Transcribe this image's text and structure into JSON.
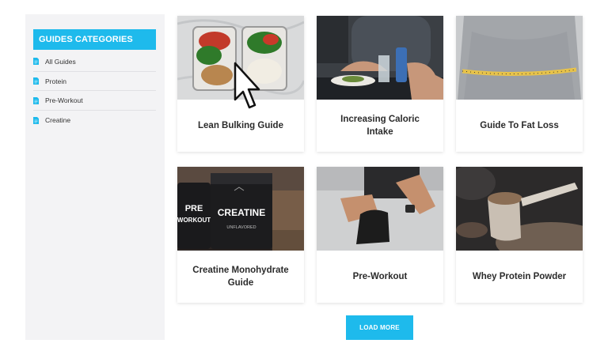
{
  "sidebar": {
    "header": "GUIDES CATEGORIES",
    "items": [
      {
        "label": "All Guides"
      },
      {
        "label": "Protein"
      },
      {
        "label": "Pre-Workout"
      },
      {
        "label": "Creatine"
      }
    ]
  },
  "cards": [
    {
      "title": "Lean Bulking Guide",
      "image": "meal-prep-containers"
    },
    {
      "title": "Increasing Caloric Intake",
      "image": "man-eating-meal"
    },
    {
      "title": "Guide To Fat Loss",
      "image": "waist-measuring-tape"
    },
    {
      "title": "Creatine Monohydrate Guide",
      "image": "supplement-tubs",
      "image_text": [
        "PRE",
        "WORKOUT",
        "CREATINE",
        "UNFLAVORED"
      ]
    },
    {
      "title": "Pre-Workout",
      "image": "tying-shoelaces"
    },
    {
      "title": "Whey Protein Powder",
      "image": "protein-powder-scoop"
    }
  ],
  "load_more_label": "LOAD MORE",
  "colors": {
    "accent": "#1ebaec",
    "sidebar_bg": "#f3f3f5",
    "title_text": "#2b2b2b"
  }
}
